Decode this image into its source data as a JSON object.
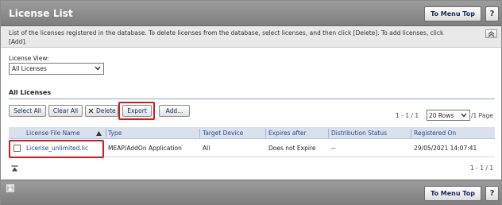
{
  "header": {
    "title": "License List",
    "menu_top_label": "To Menu Top",
    "help_label": "?"
  },
  "description": "List of the licenses registered in the database. To delete licenses from the database, select licenses, and then click [Delete]. To add licenses, click [Add].",
  "license_view": {
    "label": "License View:",
    "selected": "All Licenses"
  },
  "section": {
    "title": "All Licenses"
  },
  "toolbar": {
    "select_all": "Select All",
    "clear_all": "Clear All",
    "delete": "Delete",
    "export": "Export",
    "add": "Add..."
  },
  "pager": {
    "range_top": "1 - 1 / 1",
    "rows_selected": "20 Rows",
    "page_suffix": "/1 Page",
    "range_bottom": "1 - 1 / 1"
  },
  "table": {
    "columns": [
      "License File Name",
      "Type",
      "Target Device",
      "Expires after",
      "Distribution Status",
      "Registered On"
    ],
    "rows": [
      {
        "file_name": "License_unlimited.lic",
        "type": "MEAP/AddOn Application",
        "target_device": "All",
        "expires_after": "Does not Expire",
        "distribution_status": "--",
        "registered_on": "29/05/2021 14:07:41"
      }
    ]
  },
  "footer": {
    "menu_top_label": "To Menu Top",
    "help_label": "?"
  },
  "icons": {
    "sort": "sort-ascending-icon",
    "collapse": "collapse-up-icon",
    "scroll_top": "scroll-to-top-icon",
    "delete": "close-x-icon"
  },
  "colors": {
    "header_bg": "#8e8e8e",
    "highlight": "#d51a1a",
    "link": "#1d3f9c",
    "table_header_bg": "#d9e1ee"
  }
}
